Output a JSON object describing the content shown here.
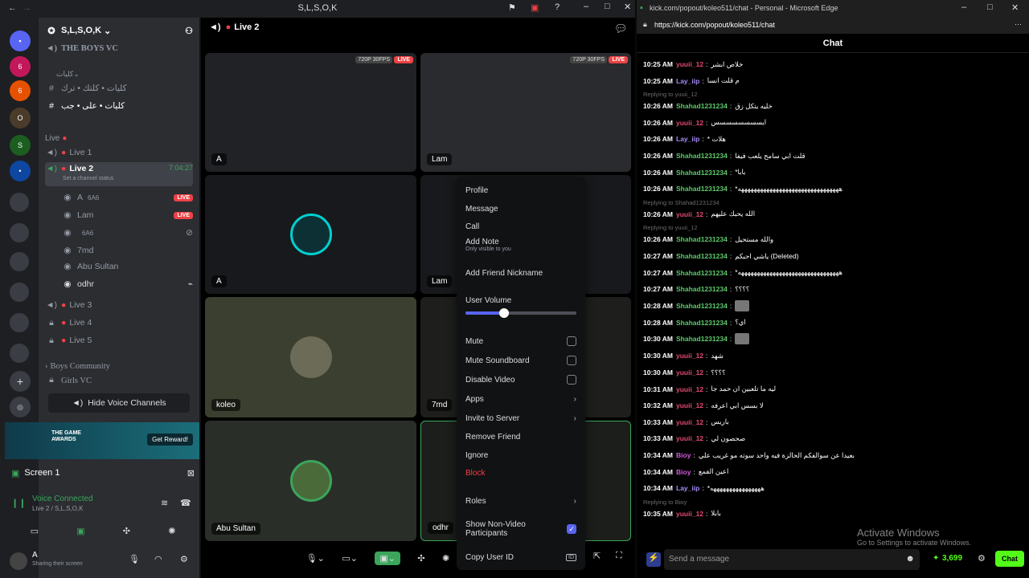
{
  "discord": {
    "window_title": "S,L,S,O,K",
    "server_name": "S,L,S,O,K",
    "vc_header": "THE BOYS VC",
    "categories": [
      "كليات",
      "Live"
    ],
    "text_channels": [
      "كليات • كلتك • ترك",
      "كليات • على • جب"
    ],
    "voice_channels": [
      {
        "name": "Live 1",
        "live": false
      },
      {
        "name": "Live 2",
        "live": true,
        "timer": "7:04:27",
        "status": "Set a channel status"
      },
      {
        "name": "Live 3",
        "live": false
      },
      {
        "name": "Live 4",
        "live": false
      },
      {
        "name": "Live 5",
        "live": false
      }
    ],
    "members": [
      {
        "name": "A",
        "tag": "6A6",
        "badge": "LIVE"
      },
      {
        "name": "Lam",
        "tag": "",
        "badge": "LIVE"
      },
      {
        "name": "",
        "tag": "6A6",
        "badge": ""
      },
      {
        "name": "7md",
        "tag": "",
        "badge": ""
      },
      {
        "name": "Abu Sultan",
        "tag": "",
        "badge": ""
      },
      {
        "name": "odhr",
        "tag": "",
        "badge": ""
      }
    ],
    "other_channels": [
      "Boys Community",
      "Girls VC"
    ],
    "hide_voice": "Hide Voice Channels",
    "promo_title": "THE GAME AWARDS",
    "promo_btn": "Get Reward!",
    "screen_label": "Screen 1",
    "voice_connected": "Voice Connected",
    "voice_loc": "Live 2 / S,L,S,O,K",
    "user_name": "A",
    "user_status": "Sharing their screen",
    "main_title": "Live 2",
    "tiles": {
      "t1_badge": "720P 30FPS",
      "t1_live": "LIVE",
      "t1_name": "A",
      "t2_badge": "720P 30FPS",
      "t2_live": "LIVE",
      "t2_name": "Lam",
      "t3": "A",
      "t4": "Lam",
      "t5": "koleo",
      "t6": "7md",
      "t7": "Abu Sultan",
      "t8": "odhr"
    }
  },
  "menu": {
    "items": [
      "Profile",
      "Message",
      "Call",
      "Add Note",
      "Add Friend Nickname",
      "User Volume",
      "Mute",
      "Mute Soundboard",
      "Disable Video",
      "Apps",
      "Invite to Server",
      "Remove Friend",
      "Ignore",
      "Block",
      "Roles",
      "Show Non-Video Participants",
      "Copy User ID"
    ],
    "note_sub": "Only visible to you",
    "id_badge": "ID",
    "volume": 0.35
  },
  "edge": {
    "title": "kick.com/popout/koleo511/chat - Personal - Microsoft Edge",
    "url": "https://kick.com/popout/koleo511/chat",
    "chat_header": "Chat",
    "messages": [
      {
        "ts": "10:25 AM",
        "u": "yuuii_12",
        "c": "#e24a70",
        "t": "خلاص ابشر"
      },
      {
        "ts": "10:25 AM",
        "u": "Lay_iip",
        "c": "#a68cf5",
        "t": "م قلت انسا"
      },
      {
        "ts": "10:26 AM",
        "u": "Shahad1231234",
        "c": "#5ec86b",
        "t": "خليه يتكل زق"
      },
      {
        "ts": "10:26 AM",
        "u": "yuuii_12",
        "c": "#e24a70",
        "t": "ايسسسسسسسس"
      },
      {
        "ts": "10:26 AM",
        "u": "Lay_iip",
        "c": "#a68cf5",
        "t": "* هلات"
      },
      {
        "ts": "10:26 AM",
        "u": "Shahad1231234",
        "c": "#5ec86b",
        "t": "قلت ابي سامح يلعب فيفا"
      },
      {
        "ts": "10:26 AM",
        "u": "Shahad1231234",
        "c": "#5ec86b",
        "t": "*بابا"
      },
      {
        "ts": "10:26 AM",
        "u": "Shahad1231234",
        "c": "#5ec86b",
        "t": "*ههههههههههههههههههههههههههههههههه"
      },
      {
        "ts": "10:26 AM",
        "u": "yuuii_12",
        "c": "#e24a70",
        "t": "الله يحبك عليهم"
      },
      {
        "ts": "10:26 AM",
        "u": "Shahad1231234",
        "c": "#5ec86b",
        "t": "والله مستحيل"
      },
      {
        "ts": "10:27 AM",
        "u": "Shahad1231234",
        "c": "#5ec86b",
        "t": "ياشي احبكم (Deleted)"
      },
      {
        "ts": "10:27 AM",
        "u": "Shahad1231234",
        "c": "#5ec86b",
        "t": "*ههههههههههههههههههههههههههههههههه"
      },
      {
        "ts": "10:27 AM",
        "u": "Shahad1231234",
        "c": "#5ec86b",
        "t": "؟؟؟؟"
      },
      {
        "ts": "10:28 AM",
        "u": "Shahad1231234",
        "c": "#5ec86b",
        "t": ""
      },
      {
        "ts": "10:28 AM",
        "u": "Shahad1231234",
        "c": "#5ec86b",
        "t": "اي؟"
      },
      {
        "ts": "10:30 AM",
        "u": "Shahad1231234",
        "c": "#5ec86b",
        "t": ""
      },
      {
        "ts": "10:30 AM",
        "u": "yuuii_12",
        "c": "#e24a70",
        "t": "شهد"
      },
      {
        "ts": "10:30 AM",
        "u": "yuuii_12",
        "c": "#e24a70",
        "t": "؟؟؟؟"
      },
      {
        "ts": "10:31 AM",
        "u": "yuuii_12",
        "c": "#e24a70",
        "t": "ليه ما تلعبين ان حمد جا"
      },
      {
        "ts": "10:32 AM",
        "u": "yuuii_12",
        "c": "#e24a70",
        "t": "لا بسس ابي اعرفه"
      },
      {
        "ts": "10:33 AM",
        "u": "yuuii_12",
        "c": "#e24a70",
        "t": "باريس"
      },
      {
        "ts": "10:33 AM",
        "u": "yuuii_12",
        "c": "#e24a70",
        "t": "صحصون لي"
      },
      {
        "ts": "10:34 AM",
        "u": "Bioy",
        "c": "#d25cd8",
        "t": "بعيدا عن سوالفكم الحالزة فيه واحد سوته مو غريب علي"
      },
      {
        "ts": "10:34 AM",
        "u": "Bioy",
        "c": "#d25cd8",
        "t": "اعين الفمع"
      },
      {
        "ts": "10:34 AM",
        "u": "Lay_iip",
        "c": "#a68cf5",
        "t": "*ههههههههههههههههه"
      },
      {
        "ts": "10:35 AM",
        "u": "yuuii_12",
        "c": "#e24a70",
        "t": "بابلا"
      }
    ],
    "replies": [
      "Replying to Shahad1231234",
      "Replying to yuuii_12",
      "Replying to Shahad1231234",
      "Replying to yuuii_12",
      "Replying to Bioy"
    ],
    "send_placeholder": "Send a message",
    "points": "3,699",
    "chat_btn": "Chat",
    "watermark_title": "Activate Windows",
    "watermark_sub": "Go to Settings to activate Windows."
  }
}
